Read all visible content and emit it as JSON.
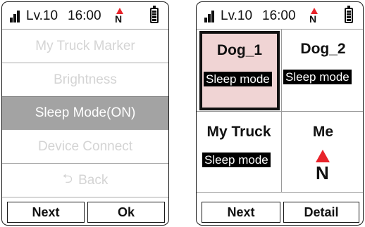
{
  "status": {
    "level": "Lv.10",
    "time": "16:00",
    "compass_letter": "N"
  },
  "left_screen": {
    "menu": [
      {
        "label": "My Truck Marker",
        "selected": false
      },
      {
        "label": "Brightness",
        "selected": false
      },
      {
        "label": "Sleep Mode(ON)",
        "selected": true
      },
      {
        "label": "Device Connect",
        "selected": false
      },
      {
        "label": "Back",
        "icon": "back-arrow-icon",
        "selected": false
      }
    ],
    "buttons": {
      "next": "Next",
      "ok": "Ok"
    }
  },
  "right_screen": {
    "cells": [
      {
        "title": "Dog_1",
        "badge": "Sleep mode",
        "selected": true
      },
      {
        "title": "Dog_2",
        "badge": "Sleep mode",
        "selected": false
      },
      {
        "title": "My Truck",
        "badge": "Sleep mode",
        "selected": false
      },
      {
        "title": "Me",
        "compass_letter": "N",
        "selected": false
      }
    ],
    "buttons": {
      "next": "Next",
      "detail": "Detail"
    }
  },
  "colors": {
    "selected_row": "#a3a3a3",
    "selected_cell": "#f0d4d4",
    "north_arrow": "#e8232a"
  }
}
